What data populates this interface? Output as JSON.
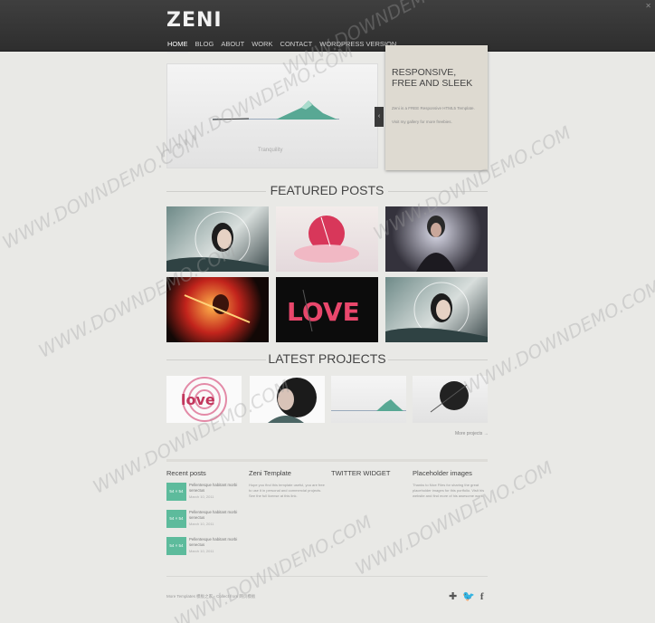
{
  "header": {
    "logo": "ZENI",
    "nav": [
      "HOME",
      "BLOG",
      "ABOUT",
      "WORK",
      "CONTACT",
      "WORDPRESS VERSION"
    ],
    "active_nav": "HOME"
  },
  "slider": {
    "caption": "Tranquility",
    "arrow": "‹"
  },
  "promo": {
    "title_line1": "RESPONSIVE,",
    "title_line2": "FREE AND SLEEK",
    "text1": "Zeni is a FREE Responsive HTML5 Template.",
    "text2": "Visit my gallery for more freebies."
  },
  "featured": {
    "title": "FEATURED POSTS"
  },
  "latest": {
    "title": "LATEST PROJECTS",
    "more_link": "More projects →"
  },
  "widgets": {
    "recent": {
      "title": "Recent posts",
      "posts": [
        {
          "badge": "54 × 54",
          "title": "Pellentesque habitant morbi senectus",
          "date": "March 10, 2011"
        },
        {
          "badge": "54 × 54",
          "title": "Pellentesque habitant morbi senectus",
          "date": "March 10, 2011"
        },
        {
          "badge": "54 × 54",
          "title": "Pellentesque habitant morbi senectus",
          "date": "March 10, 2011"
        }
      ]
    },
    "template": {
      "title": "Zeni Template",
      "text": "Hope you find this template useful, you are free to use it in personal and commercial projects. See the full license at this link."
    },
    "twitter": {
      "title": "TWITTER WIDGET"
    },
    "placeholder": {
      "title": "Placeholder images",
      "text": "Thanks to Nice Files for sharing the great placeholder images for this portfolio. Visit his website and find more of his awesome work."
    }
  },
  "footer": {
    "text": "More Templates 模板之家 - Collect from 网页模板",
    "icons": [
      "plus-icon",
      "twitter-icon",
      "facebook-icon"
    ]
  },
  "watermark": "WWW.DOWNDEMO.COM",
  "colors": {
    "accent": "#5dbb9c",
    "topbar": "#333333",
    "background": "#e9e9e6",
    "promo": "#dedad1"
  }
}
